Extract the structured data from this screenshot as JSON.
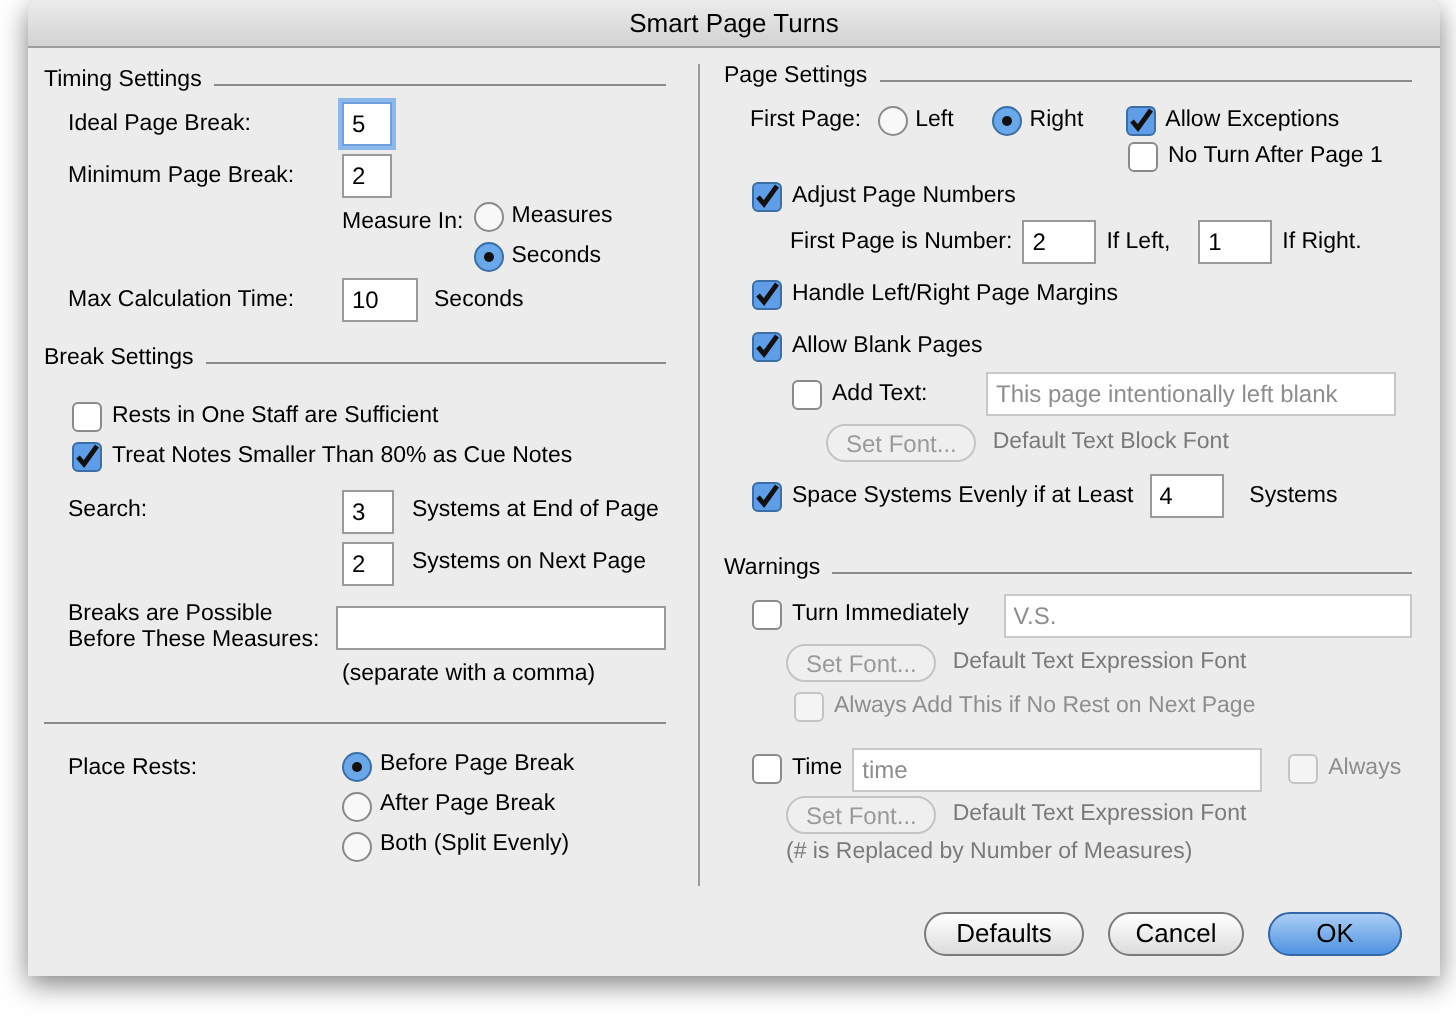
{
  "window": {
    "title": "Smart Page Turns"
  },
  "timing": {
    "title": "Timing Settings",
    "ideal": {
      "label": "Ideal Page Break:",
      "value": "5",
      "focused": true
    },
    "minimum": {
      "label": "Minimum Page Break:",
      "value": "2",
      "focused": false
    },
    "measure_in": {
      "label": "Measure In:",
      "options": [
        {
          "label": "Measures",
          "selected": false
        },
        {
          "label": "Seconds",
          "selected": true
        }
      ]
    },
    "max_time": {
      "label": "Max Calculation Time:",
      "value": "10",
      "unit": "Seconds"
    }
  },
  "break_settings": {
    "title": "Break Settings",
    "checkboxes": [
      {
        "label": "Rests in One Staff are Sufficient",
        "checked": false
      },
      {
        "label": "Treat Notes Smaller Than 80% as Cue Notes",
        "checked": true
      }
    ],
    "search": {
      "label": "Search:",
      "rows": [
        {
          "value": "3",
          "unit": "Systems at End of Page"
        },
        {
          "value": "2",
          "unit": "Systems on Next Page"
        }
      ]
    },
    "breaks_possible": {
      "label": "Breaks are Possible Before These Measures:",
      "hint": "(separate with a comma)"
    }
  },
  "place_rests": {
    "label": "Place Rests:",
    "options": [
      {
        "label": "Before Page Break",
        "selected": true
      },
      {
        "label": "After Page Break",
        "selected": false
      },
      {
        "label": "Both (Split Evenly)",
        "selected": false
      }
    ]
  },
  "page_settings": {
    "title": "Page Settings",
    "first_page": {
      "label": "First Page:",
      "options": [
        {
          "label": "Left",
          "selected": false
        },
        {
          "label": "Right",
          "selected": true
        }
      ]
    },
    "allow_exceptions": {
      "label": "Allow Exceptions",
      "checked": true
    },
    "no_turn": {
      "label": "No Turn After Page 1",
      "checked": false
    },
    "adjust": {
      "label": "Adjust Page Numbers",
      "checked": true
    },
    "first_number": {
      "label": "First Page is Number:",
      "left_value": "2",
      "left_label": "If Left,",
      "right_value": "1",
      "right_label": "If Right."
    },
    "margins": {
      "label": "Handle Left/Right Page Margins",
      "checked": true
    },
    "blank": {
      "label": "Allow Blank Pages",
      "checked": true
    },
    "add_text": {
      "label": "Add Text:",
      "checked": false,
      "value": "This page intentionally left blank",
      "disabled": true
    },
    "set_font": {
      "label": "Set Font...",
      "disabled": true
    },
    "font_note": "Default Text Block Font",
    "space": {
      "label": "Space Systems Evenly if at Least",
      "checked": true,
      "value": "4",
      "unit": "Systems"
    }
  },
  "warnings": {
    "title": "Warnings",
    "turn": {
      "label": "Turn Immediately",
      "checked": false,
      "value": "V.S.",
      "disabled": true
    },
    "turn_font": {
      "label": "Set Font...",
      "disabled": true
    },
    "turn_font_note": "Default Text Expression Font",
    "always_add": {
      "label": "Always Add This if No Rest on Next Page",
      "checked": false,
      "disabled": true
    },
    "time": {
      "label": "Time",
      "checked": false,
      "value": "time",
      "disabled": true
    },
    "always": {
      "label": "Always",
      "checked": false,
      "disabled": true
    },
    "time_font": {
      "label": "Set Font...",
      "disabled": true
    },
    "time_font_note": "Default Text Expression Font",
    "time_hint": "(# is Replaced by Number of Measures)"
  },
  "buttons": [
    {
      "label": "Defaults",
      "default": false
    },
    {
      "label": "Cancel",
      "default": false
    },
    {
      "label": "OK",
      "default": true
    }
  ]
}
